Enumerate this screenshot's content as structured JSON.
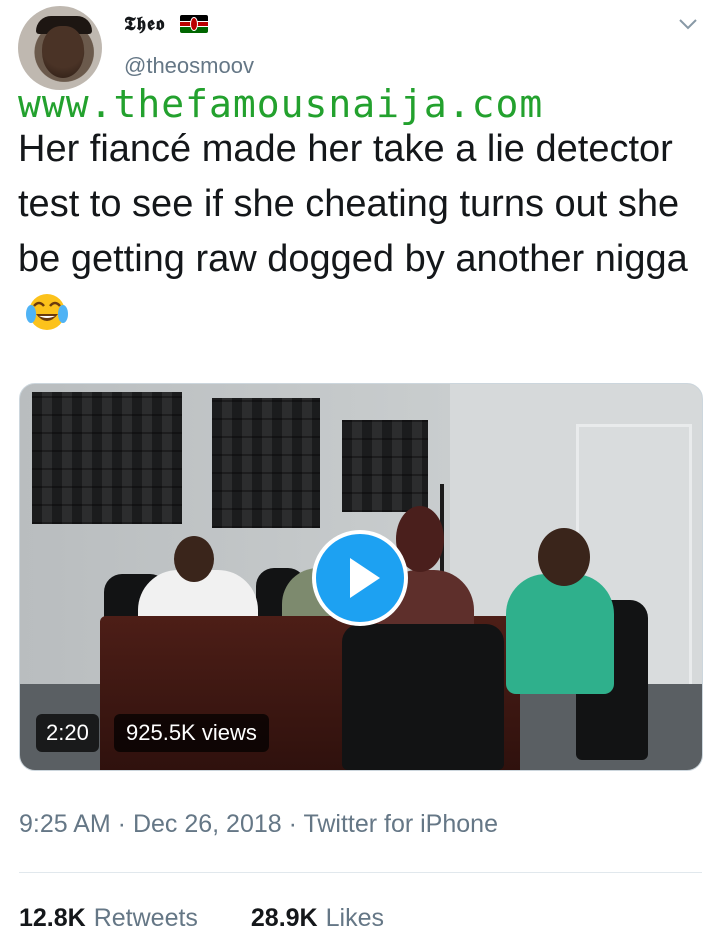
{
  "author": {
    "display_name": "𝕿𝖍𝖊𝖔",
    "handle": "@theosmoov",
    "flag_icon": "kenya-flag-icon"
  },
  "watermark": "www.thefamousnaija.com",
  "tweet": {
    "text": "Her fiancé made her take a lie detector test to see if she cheating turns out she be getting raw dogged by another nigga",
    "emoji_icon": "face-with-tears-of-joy-icon"
  },
  "video": {
    "duration": "2:20",
    "views": "925.5K views",
    "play_icon": "play-icon"
  },
  "meta": {
    "time": "9:25 AM",
    "separator": " · ",
    "date": "Dec 26, 2018",
    "source": "Twitter for iPhone"
  },
  "stats": {
    "retweets_count": "12.8K",
    "retweets_label": "Retweets",
    "likes_count": "28.9K",
    "likes_label": "Likes"
  },
  "colors": {
    "accent": "#1da1f2",
    "secondary_text": "#657786",
    "watermark": "#23a12e"
  }
}
